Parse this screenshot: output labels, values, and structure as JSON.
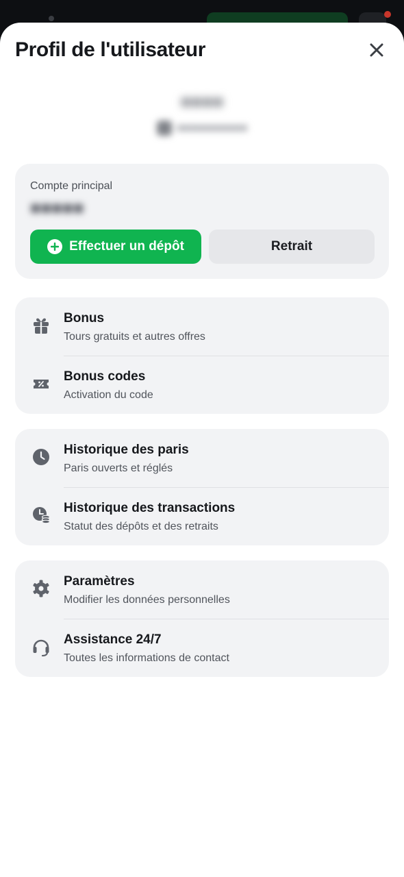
{
  "header": {
    "title": "Profil de l'utilisateur",
    "close_icon": "close-icon"
  },
  "account": {
    "label": "Compte principal",
    "deposit_label": "Effectuer un dépôt",
    "withdraw_label": "Retrait",
    "accent": "#10b450"
  },
  "sections": [
    {
      "items": [
        {
          "title": "Bonus",
          "subtitle": "Tours gratuits et autres offres",
          "icon": "gift-icon"
        },
        {
          "title": "Bonus codes",
          "subtitle": "Activation du code",
          "icon": "promo-ticket-icon"
        }
      ]
    },
    {
      "items": [
        {
          "title": "Historique des paris",
          "subtitle": "Paris ouverts et réglés",
          "icon": "clock-icon"
        },
        {
          "title": "Historique des transactions",
          "subtitle": "Statut des dépôts et des retraits",
          "icon": "clock-coins-icon"
        }
      ]
    },
    {
      "items": [
        {
          "title": "Paramètres",
          "subtitle": "Modifier les données personnelles",
          "icon": "gear-icon"
        },
        {
          "title": "Assistance 24/7",
          "subtitle": "Toutes les informations de contact",
          "icon": "headset-icon"
        }
      ]
    }
  ]
}
